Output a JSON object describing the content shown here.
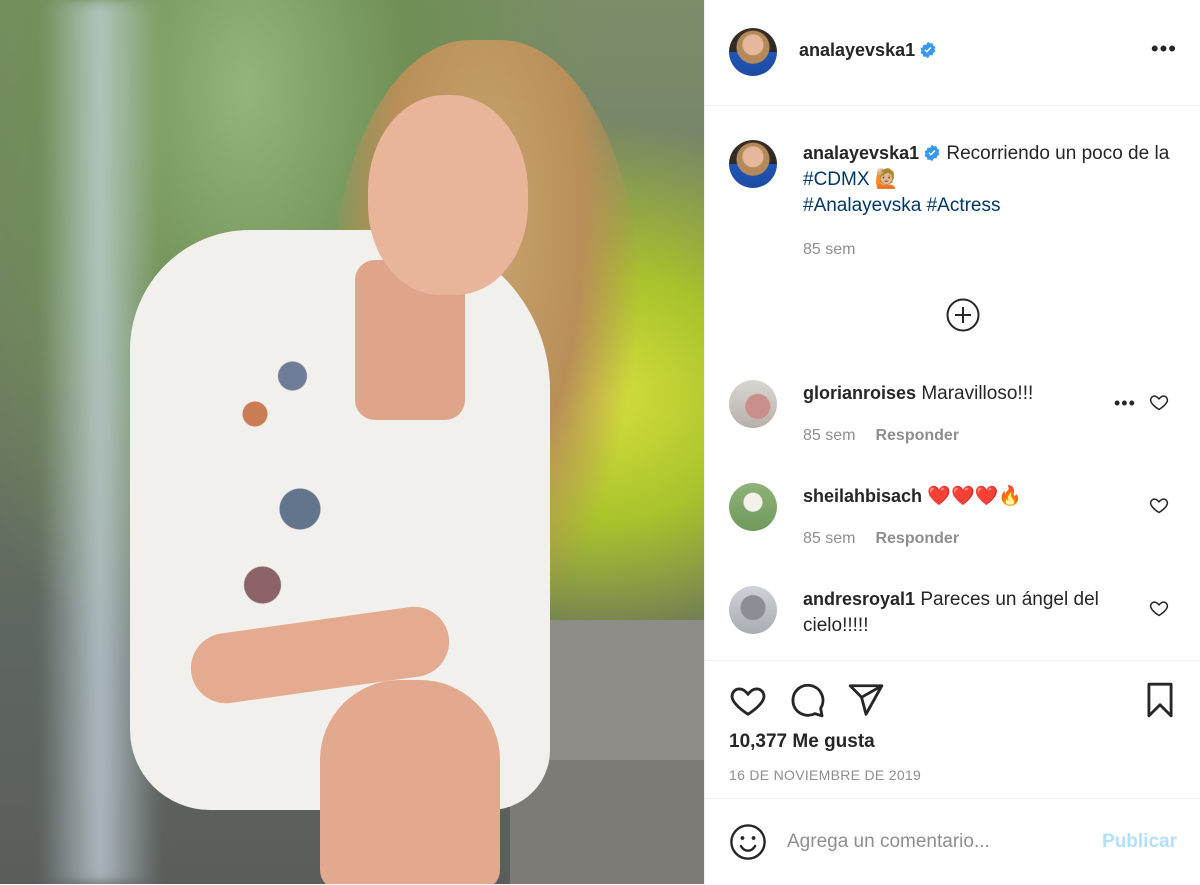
{
  "post": {
    "username": "analayevska1",
    "caption_text": " Recorriendo un poco de la ",
    "hashtag_cdmx": "#CDMX",
    "emoji_after": " 🙋🏼",
    "hashtags_line": "#Analayevska #Actress",
    "caption_time": "85 sem",
    "likes": "10,377 Me gusta",
    "date": "16 DE NOVIEMBRE DE 2019"
  },
  "comments": [
    {
      "user": "glorianroises",
      "text": " Maravilloso!!!",
      "time": "85 sem",
      "reply": "Responder"
    },
    {
      "user": "sheilahbisach",
      "text": " ❤️❤️❤️🔥",
      "time": "85 sem",
      "reply": "Responder"
    },
    {
      "user": "andresroyal1",
      "text": " Pareces un ángel del cielo!!!!!"
    }
  ],
  "add_comment": {
    "placeholder": "Agrega un comentario...",
    "publish": "Publicar"
  },
  "icons": {
    "more": "more-options-icon",
    "verified": "verified-badge-icon",
    "plus": "load-more-comments-icon",
    "like": "heart-icon",
    "comment": "comment-icon",
    "share": "share-icon",
    "save": "bookmark-icon",
    "emoji": "emoji-icon"
  },
  "colors": {
    "accent": "#0095f6",
    "link": "#00376b",
    "muted": "#8e8e8e",
    "publish_disabled": "#b2dffc"
  }
}
